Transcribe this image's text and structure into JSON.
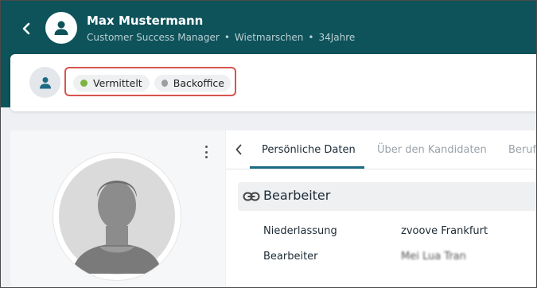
{
  "header": {
    "name": "Max Mustermann",
    "role": "Customer Success Manager",
    "location": "Wietmarschen",
    "age": "34Jahre",
    "separator": "•"
  },
  "status": {
    "chips": [
      {
        "label": "Vermittelt",
        "color": "#7cb342"
      },
      {
        "label": "Backoffice",
        "color": "#9e9e9e"
      }
    ]
  },
  "tabs": [
    {
      "label": "Persönliche Daten",
      "active": true
    },
    {
      "label": "Über den Kandidaten",
      "active": false
    },
    {
      "label": "Beruf",
      "active": false
    }
  ],
  "section": {
    "title": "Bearbeiter",
    "icon": "link-icon",
    "rows": [
      {
        "label": "Niederlassung",
        "value": "zvoove Frankfurt"
      },
      {
        "label": "Bearbeiter",
        "value": "Mei Lua Tran"
      }
    ]
  },
  "colors": {
    "header_bg": "#0e525a",
    "accent": "#1c6a84",
    "highlight_border": "#d9534f"
  }
}
